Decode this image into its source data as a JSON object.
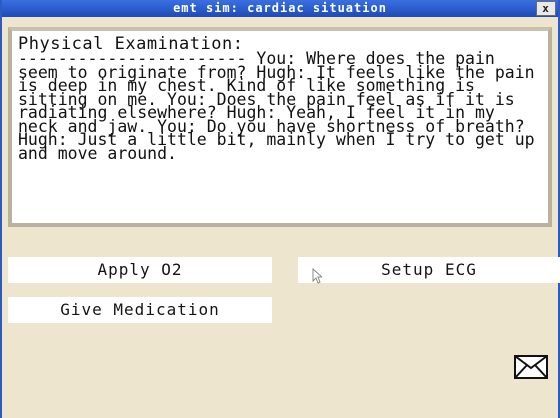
{
  "window": {
    "title": "emt sim: cardiac situation",
    "close_glyph": "x"
  },
  "panel": {
    "heading": "Physical Examination:",
    "body": "----------------------- You: Where does the pain seem to originate from? Hugh: It feels like the pain is deep in my chest. Kind of like something is sitting on me. You: Does the pain feel as if it is radiating elsewhere? Hugh: Yeah, I feel it in my neck and jaw. You: Do you have shortness of breath? Hugh: Just a little bit, mainly when I try to get up and move around."
  },
  "buttons": {
    "apply_o2": "Apply O2",
    "setup_ecg": "Setup ECG",
    "give_medication": "Give Medication"
  },
  "icons": {
    "mail": "envelope-icon",
    "cursor": "pointer-cursor-icon"
  },
  "colors": {
    "titlebar": "#2c5bc4",
    "background": "#ede5cd",
    "panel_border": "#b9b2a1"
  }
}
